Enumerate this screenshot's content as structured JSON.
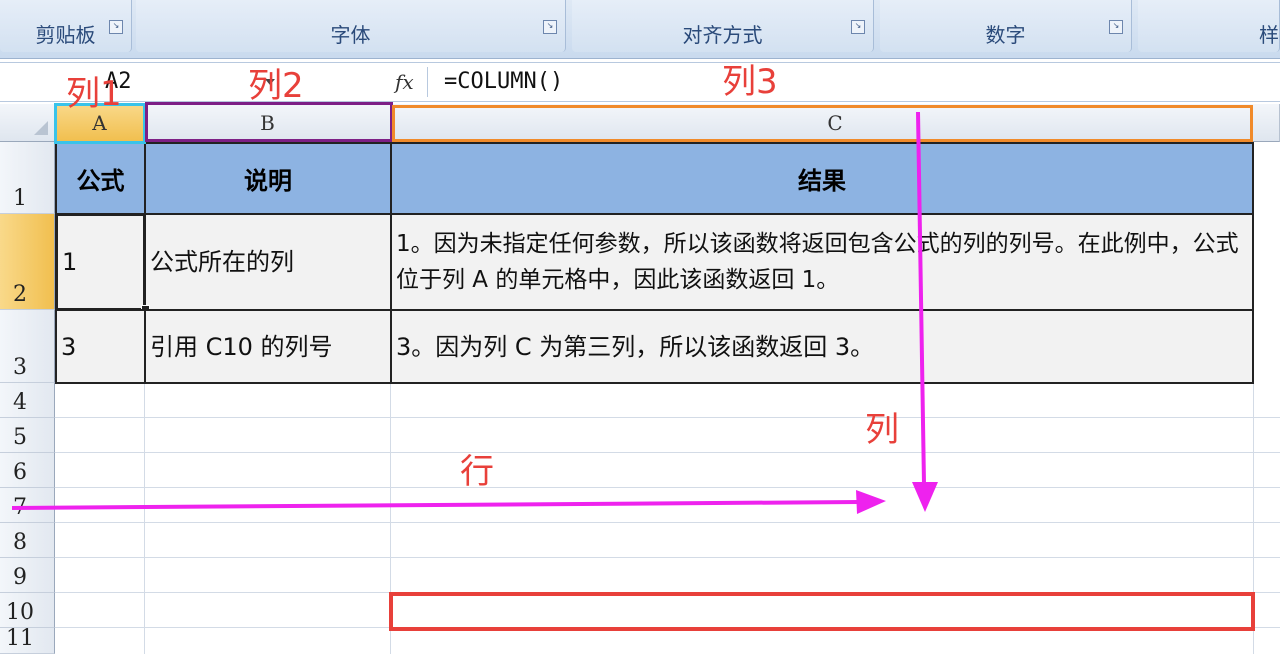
{
  "ribbon": {
    "groups": [
      {
        "label": "剪贴板"
      },
      {
        "label": "字体"
      },
      {
        "label": "对齐方式"
      },
      {
        "label": "数字"
      },
      {
        "label": "样"
      }
    ]
  },
  "formula_bar": {
    "name_box": "A2",
    "fx_label": "fx",
    "formula": "=COLUMN()"
  },
  "columns": [
    "A",
    "B",
    "C"
  ],
  "rows": [
    "1",
    "2",
    "3",
    "4",
    "5",
    "6",
    "7",
    "8",
    "9",
    "10",
    "11"
  ],
  "table": {
    "headers": [
      "公式",
      "说明",
      "结果"
    ],
    "rows": [
      [
        "1",
        "公式所在的列",
        "1。因为未指定任何参数，所以该函数将返回包含公式的列的列号。在此例中，公式位于列 A 的单元格中，因此该函数返回 1。"
      ],
      [
        "3",
        "引用 C10 的列号",
        "3。因为列 C 为第三列，所以该函数返回 3。"
      ]
    ]
  },
  "annotations": {
    "col1": "列1",
    "col2": "列2",
    "col3": "列3",
    "row": "行",
    "column": "列"
  },
  "colors": {
    "col1_box": "#39c3ea",
    "col2_box": "#7d1f86",
    "col3_box": "#f08a2a",
    "arrow": "#ee22ee",
    "c10_box": "#e8403a",
    "header_fill": "#8db3e2"
  }
}
